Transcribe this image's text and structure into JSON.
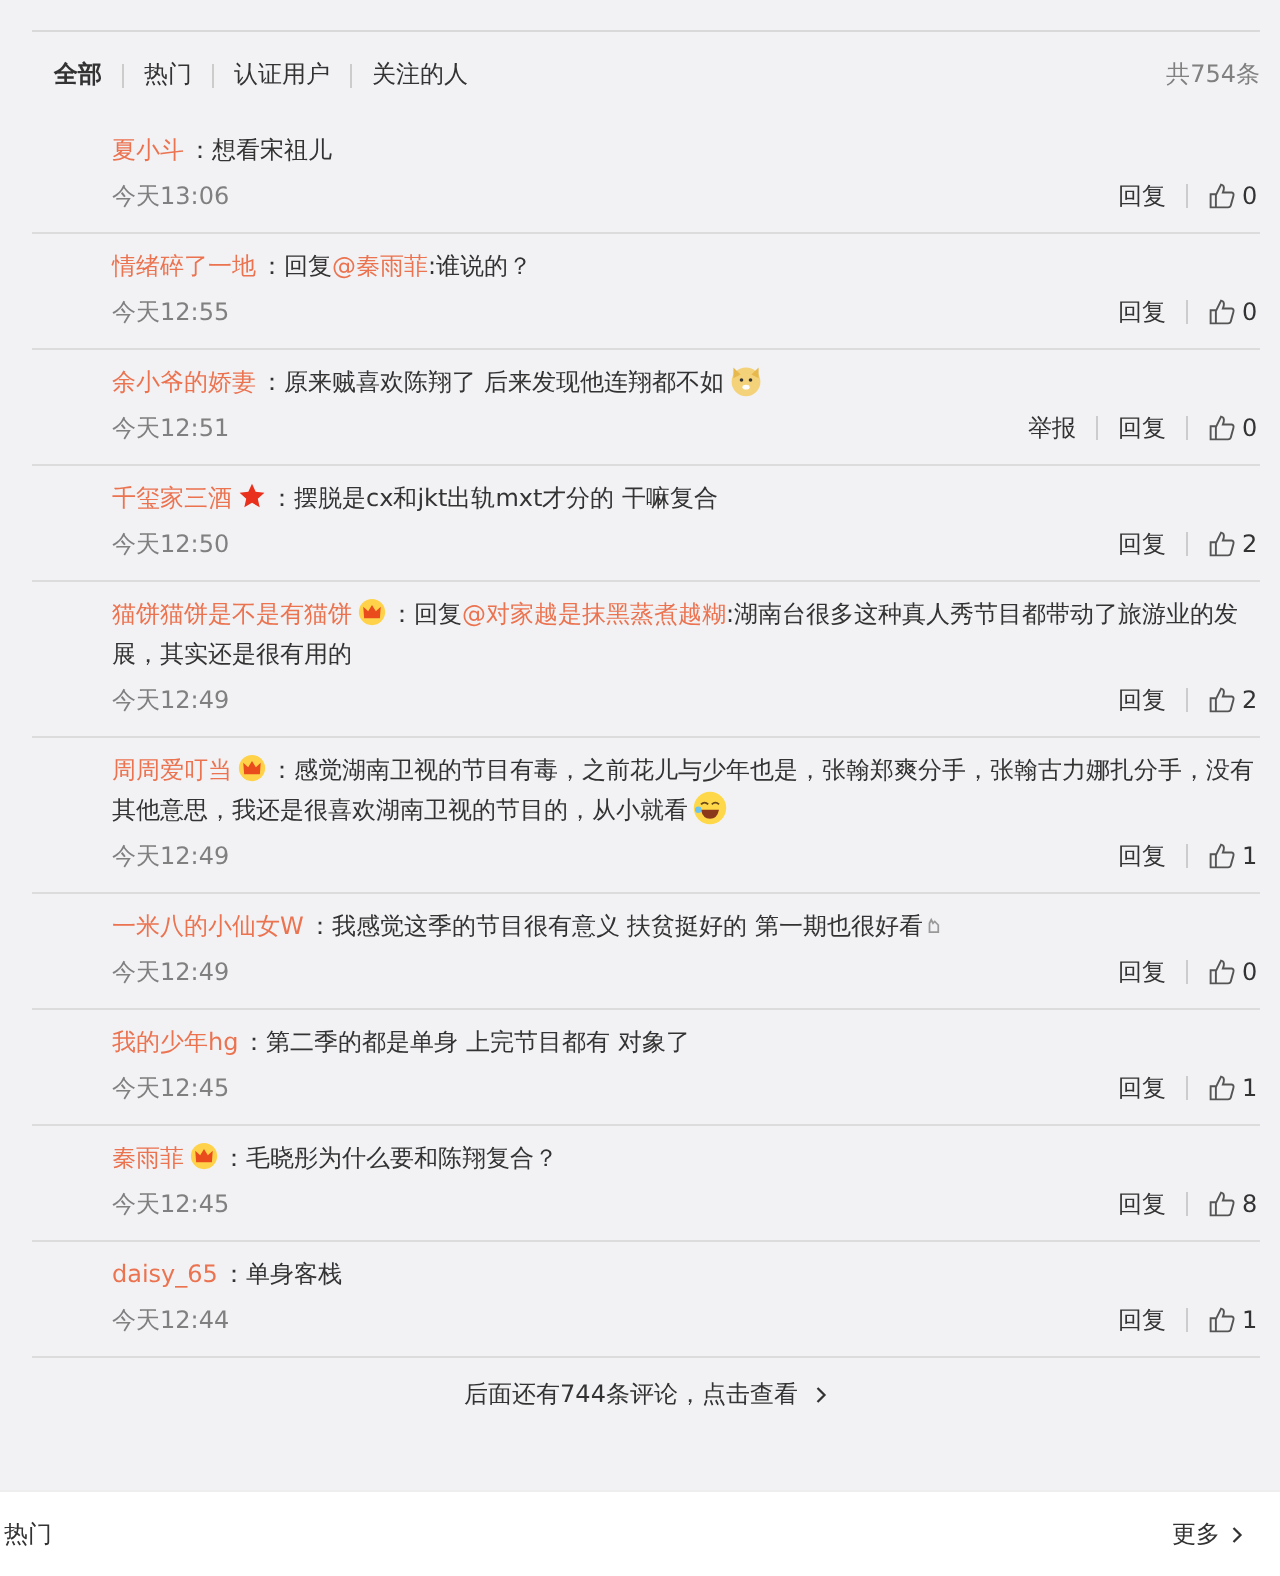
{
  "tabs": [
    {
      "label": "全部",
      "selected": true
    },
    {
      "label": "热门",
      "selected": false
    },
    {
      "label": "认证用户",
      "selected": false
    },
    {
      "label": "关注的人",
      "selected": false
    }
  ],
  "total": "共754条",
  "comments": [
    {
      "user": "夏小斗",
      "colon": "：",
      "text": "想看宋祖儿",
      "time": "今天13:06",
      "reply": "回复",
      "likes": "0"
    },
    {
      "user": "情绪碎了一地",
      "colon": "：",
      "prefix": "回复",
      "mention": "@秦雨菲",
      "text": ":谁说的？",
      "time": "今天12:55",
      "reply": "回复",
      "likes": "0"
    },
    {
      "user": "余小爷的娇妻",
      "colon": "：",
      "text": "原来贼喜欢陈翔了 后来发现他连翔都不如",
      "emoji": {
        "kind": "dog"
      },
      "time": "今天12:51",
      "report": "举报",
      "reply": "回复",
      "likes": "0"
    },
    {
      "user": "千玺家三酒",
      "badge": {
        "kind": "star"
      },
      "colon": "：",
      "text": "摆脱是cx和jkt出轨mxt才分的 干嘛复合",
      "time": "今天12:50",
      "reply": "回复",
      "likes": "2"
    },
    {
      "user": "猫饼猫饼是不是有猫饼",
      "badge": {
        "kind": "crown"
      },
      "colon": "：",
      "prefix": "回复",
      "mention": "@对家越是抹黑蒸煮越糊",
      "text": ":湖南台很多这种真人秀节目都带动了旅游业的发展，其实还是很有用的",
      "time": "今天12:49",
      "reply": "回复",
      "likes": "2"
    },
    {
      "user": "周周爱叮当",
      "badge": {
        "kind": "crown"
      },
      "colon": "：",
      "text": "感觉湖南卫视的节目有毒，之前花儿与少年也是，张翰郑爽分手，张翰古力娜扎分手，没有其他意思，我还是很喜欢湖南卫视的节目的，从小就看",
      "emoji": {
        "kind": "laugh"
      },
      "time": "今天12:49",
      "reply": "回复",
      "likes": "1"
    },
    {
      "user": "一米八的小仙女W",
      "colon": "：",
      "text": "我感觉这季的节目很有意义 扶贫挺好的 第一期也很好看",
      "emoji": {
        "kind": "tiny"
      },
      "time": "今天12:49",
      "reply": "回复",
      "likes": "0"
    },
    {
      "user": "我的少年hg",
      "colon": "：",
      "text": "第二季的都是单身 上完节目都有 对象了",
      "time": "今天12:45",
      "reply": "回复",
      "likes": "1"
    },
    {
      "user": "秦雨菲",
      "badge": {
        "kind": "crown"
      },
      "colon": "：",
      "text": "毛晓彤为什么要和陈翔复合？",
      "time": "今天12:45",
      "reply": "回复",
      "likes": "8"
    },
    {
      "user": "daisy_65",
      "colon": "：",
      "text": "单身客栈",
      "time": "今天12:44",
      "reply": "回复",
      "likes": "1"
    }
  ],
  "more_comments": "后面还有744条评论，点击查看",
  "footer": {
    "label": "热门",
    "more": "更多"
  }
}
